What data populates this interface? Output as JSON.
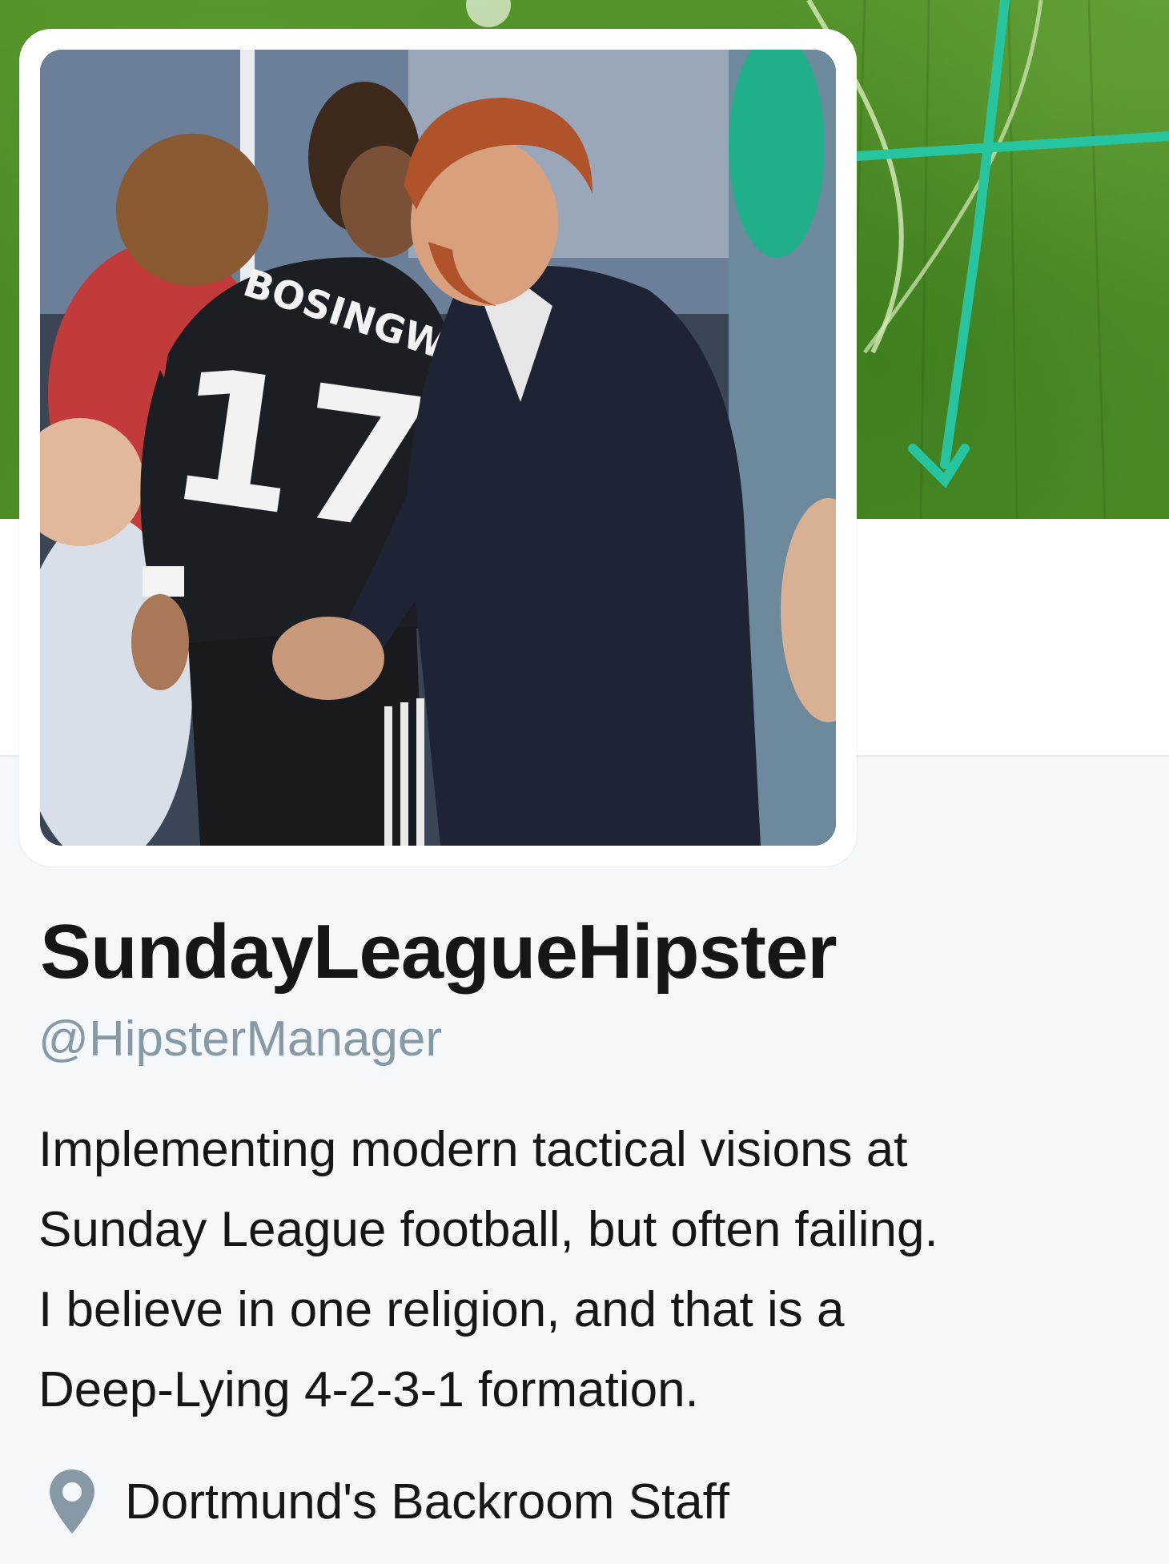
{
  "profile": {
    "display_name": "SundayLeagueHipster",
    "handle": "@HipsterManager",
    "bio_lines": [
      "Implementing modern tactical visions at",
      "Sunday League football, but often failing.",
      "I believe in one religion, and that is a",
      "Deep-Lying 4-2-3-1 formation."
    ],
    "location": "Dortmund's Backroom Staff",
    "avatar": {
      "shirt_name": "BOSINGWA",
      "shirt_number": "17"
    }
  },
  "icons": {
    "location": "location-pin-icon"
  },
  "colors": {
    "page_background": "#f5f8fa",
    "name_text": "#14171a",
    "handle_text": "#8899a6",
    "pin_icon": "#8899a6",
    "banner_grass": "#4e8f26"
  }
}
